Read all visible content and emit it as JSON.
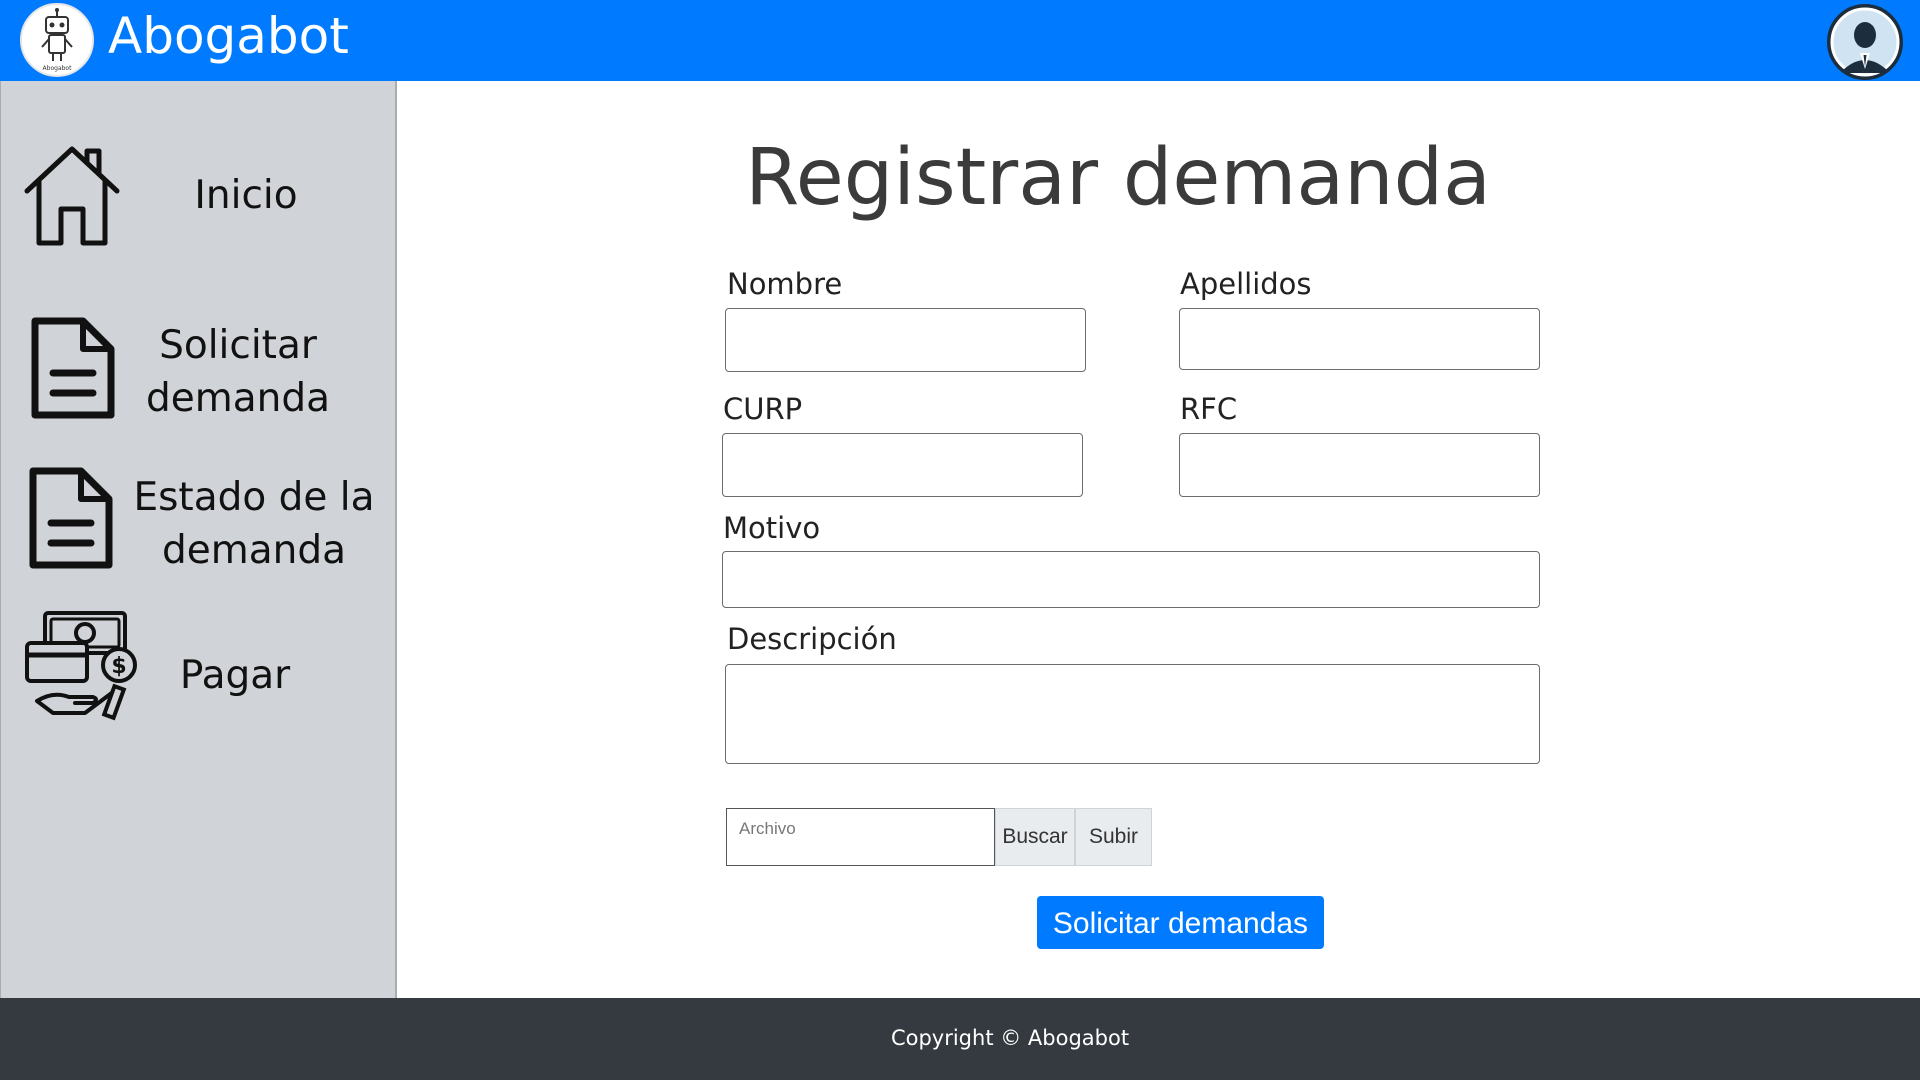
{
  "header": {
    "brand": "Abogabot",
    "logo_icon": "robot-logo-icon",
    "logo_text": "Abogabot",
    "avatar_icon": "user-avatar-icon",
    "color": "#007bff"
  },
  "sidebar": {
    "items": [
      {
        "label": "Inicio",
        "icon": "home-icon"
      },
      {
        "label": "Solicitar\ndemanda",
        "icon": "document-icon"
      },
      {
        "label": "Estado de la\ndemanda",
        "icon": "document-icon"
      },
      {
        "label": "Pagar",
        "icon": "payment-icon"
      }
    ]
  },
  "main": {
    "title": "Registrar demanda",
    "fields": {
      "nombre": {
        "label": "Nombre",
        "value": ""
      },
      "apellidos": {
        "label": "Apellidos",
        "value": ""
      },
      "curp": {
        "label": "CURP",
        "value": ""
      },
      "rfc": {
        "label": "RFC",
        "value": ""
      },
      "motivo": {
        "label": "Motivo",
        "value": ""
      },
      "descripcion": {
        "label": "Descripción",
        "value": ""
      }
    },
    "file": {
      "placeholder": "Archivo",
      "browse_label": "Buscar",
      "upload_label": "Subir"
    },
    "submit_label": "Solicitar demandas"
  },
  "footer": {
    "text": "Copyright © Abogabot"
  }
}
